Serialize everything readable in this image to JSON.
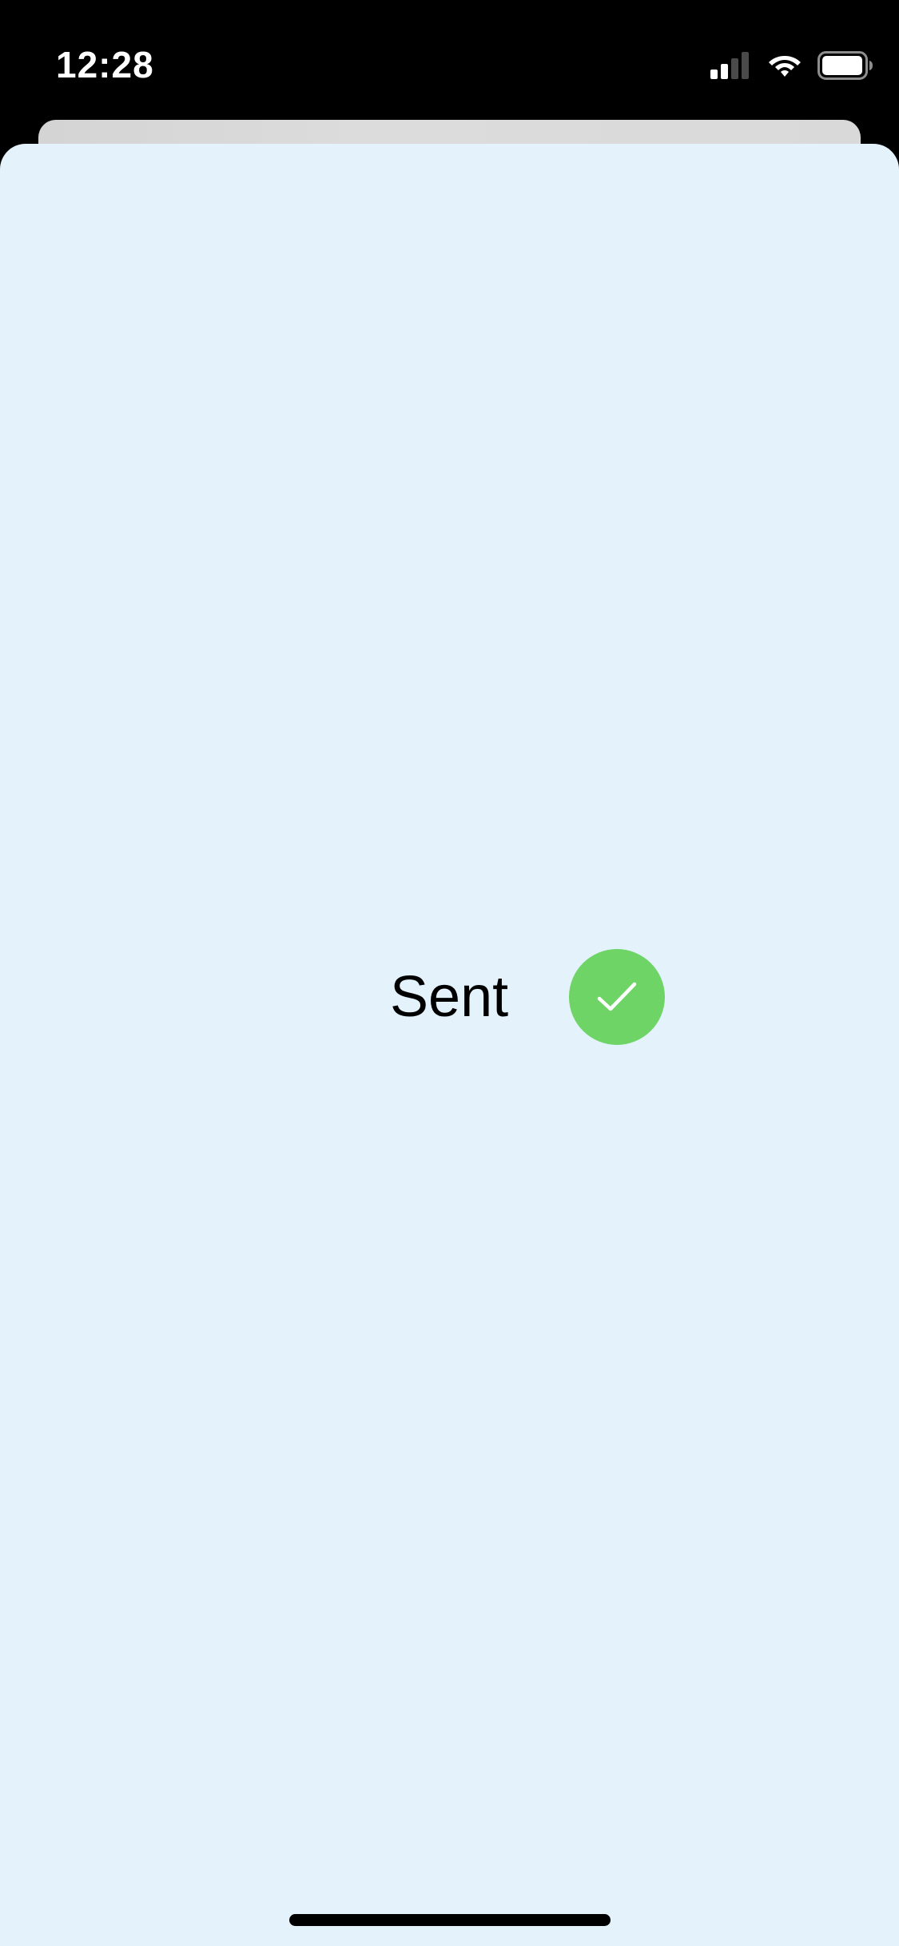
{
  "status_bar": {
    "time": "12:28",
    "signal_icon": "cellular-signal-icon",
    "wifi_icon": "wifi-icon",
    "battery_icon": "battery-icon"
  },
  "sheet": {
    "background_color": "#e4f2fc",
    "status_text": "Sent",
    "status_icon": "checkmark-icon",
    "status_icon_color": "#6dd465"
  }
}
